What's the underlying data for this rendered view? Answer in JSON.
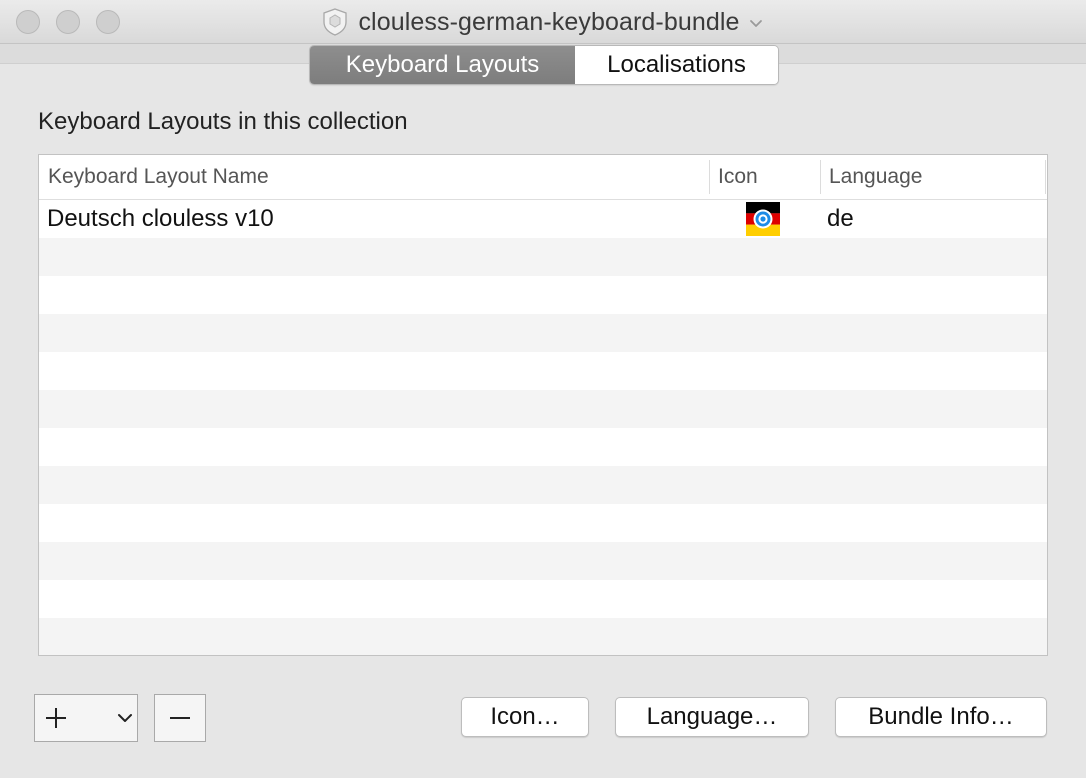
{
  "window": {
    "title": "clouless-german-keyboard-bundle",
    "title_icon": "bundle-shield-icon",
    "title_menu_icon": "chevron-down-icon"
  },
  "tabs": [
    {
      "label": "Keyboard Layouts",
      "selected": true
    },
    {
      "label": "Localisations",
      "selected": false
    }
  ],
  "section": {
    "label": "Keyboard Layouts in this collection"
  },
  "table": {
    "columns": [
      "Keyboard Layout Name",
      "Icon",
      "Language"
    ],
    "rows": [
      {
        "name": "Deutsch clouless v10",
        "icon": "german-flag-icon",
        "language": "de"
      }
    ],
    "empty_row_count": 11
  },
  "buttons": {
    "add_icon": "plus-icon",
    "add_menu_icon": "chevron-down-icon",
    "remove_icon": "minus-icon",
    "icon": "Icon…",
    "language": "Language…",
    "bundle_info": "Bundle Info…"
  },
  "colors": {
    "selected_tab": "#878787",
    "flag_black": "#000000",
    "flag_red": "#dd0000",
    "flag_gold": "#ffce00",
    "flag_target_blue": "#1e8ce6"
  }
}
